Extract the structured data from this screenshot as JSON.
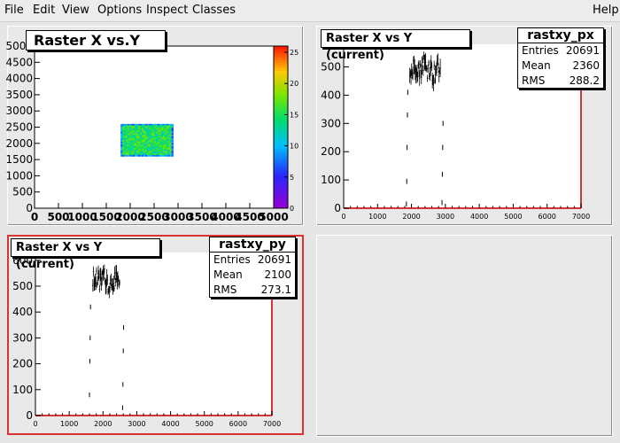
{
  "menu": {
    "file": "File",
    "edit": "Edit",
    "view": "View",
    "options": "Options",
    "inspect": "Inspect",
    "classes": "Classes",
    "help": "Help"
  },
  "pad1": {
    "title": "Raster X vs.Y",
    "xticks": [
      "0",
      "500",
      "1000",
      "1500",
      "2000",
      "2500",
      "3000",
      "3500",
      "4000",
      "4500",
      "5000"
    ],
    "yticks": [
      "0",
      "500",
      "1000",
      "1500",
      "2000",
      "2500",
      "3000",
      "3500",
      "4000",
      "4500",
      "5000"
    ],
    "zticks": [
      "0",
      "5",
      "10",
      "15",
      "20",
      "25"
    ]
  },
  "pad2": {
    "title": "Raster X vs Y (current)",
    "stats": {
      "name": "rastxy_px",
      "entries_label": "Entries",
      "entries": "20691",
      "mean_label": "Mean",
      "mean": "2360",
      "rms_label": "RMS",
      "rms": "288.2"
    },
    "xticks": [
      "0",
      "1000",
      "2000",
      "3000",
      "4000",
      "5000",
      "6000",
      "7000"
    ],
    "yticks": [
      "0",
      "100",
      "200",
      "300",
      "400",
      "500"
    ]
  },
  "pad3": {
    "title": "Raster X vs Y (current)",
    "stats": {
      "name": "rastxy_py",
      "entries_label": "Entries",
      "entries": "20691",
      "mean_label": "Mean",
      "mean": "2100",
      "rms_label": "RMS",
      "rms": "273.1"
    },
    "xticks": [
      "0",
      "1000",
      "2000",
      "3000",
      "4000",
      "5000",
      "6000",
      "7000"
    ],
    "yticks": [
      "0",
      "100",
      "200",
      "300",
      "400",
      "500",
      "600"
    ]
  },
  "chart_data": [
    {
      "type": "heatmap",
      "title": "Raster X vs.Y",
      "xlim": [
        0,
        5000
      ],
      "ylim": [
        0,
        5000
      ],
      "zlim": [
        0,
        26
      ],
      "region": {
        "x": [
          1800,
          2900
        ],
        "y": [
          1600,
          2600
        ]
      }
    },
    {
      "type": "scatter",
      "title": "Raster X vs Y (current)",
      "xlim": [
        0,
        7000
      ],
      "ylim": [
        0,
        580
      ],
      "profile_x": [
        1950,
        2050,
        2150,
        2250,
        2350,
        2450,
        2550,
        2650,
        2750,
        2850
      ],
      "profile_y": [
        470,
        495,
        510,
        480,
        520,
        490,
        505,
        470,
        500,
        485
      ],
      "edge_points": [
        [
          1850,
          15
        ],
        [
          1860,
          95
        ],
        [
          1870,
          215
        ],
        [
          1880,
          330
        ],
        [
          1890,
          410
        ],
        [
          2900,
          20
        ],
        [
          2910,
          120
        ],
        [
          2920,
          215
        ],
        [
          2930,
          300
        ]
      ]
    },
    {
      "type": "scatter",
      "title": "Raster X vs Y (current)",
      "xlim": [
        0,
        7000
      ],
      "ylim": [
        0,
        630
      ],
      "profile_x": [
        1700,
        1800,
        1900,
        2000,
        2100,
        2200,
        2300,
        2400,
        2500
      ],
      "profile_y": [
        520,
        535,
        510,
        545,
        525,
        500,
        530,
        515,
        505
      ],
      "edge_points": [
        [
          1600,
          80
        ],
        [
          1610,
          210
        ],
        [
          1620,
          300
        ],
        [
          1630,
          420
        ],
        [
          2580,
          30
        ],
        [
          2590,
          120
        ],
        [
          2600,
          250
        ],
        [
          2610,
          340
        ]
      ]
    }
  ]
}
